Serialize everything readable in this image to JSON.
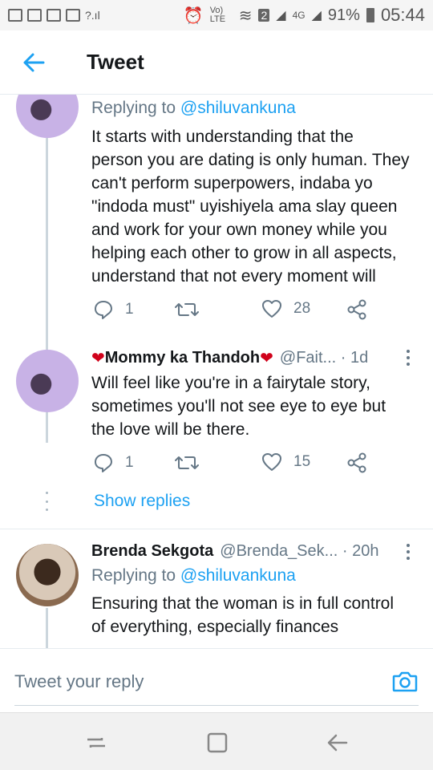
{
  "status_bar": {
    "carrier_lte": "Vo) LTE",
    "sim_slot": "2",
    "network": "4G",
    "battery": "91%",
    "time": "05:44"
  },
  "header": {
    "title": "Tweet"
  },
  "tweets": [
    {
      "replying_prefix": "Replying to ",
      "replying_handle": "@shiluvankuna",
      "lines": [
        "It starts with understanding that the",
        "person you are dating is only human. They",
        "can't perform superpowers, indaba yo",
        "\"indoda must\" uyishiyela ama slay queen",
        "and work for your own money while you",
        "helping each other to grow in all aspects,",
        "understand that not every moment will"
      ],
      "replies": "1",
      "likes": "28"
    },
    {
      "name": "Mommy ka Thandoh",
      "handle_time": "@Fait... · 1d",
      "lines": [
        "Will feel like you're in a fairytale story,",
        "sometimes you'll not see eye to eye but",
        "the love will be there."
      ],
      "replies": "1",
      "likes": "15",
      "show_replies": "Show replies"
    },
    {
      "name": "Brenda Sekgota",
      "handle_time": "@Brenda_Sek... · 20h",
      "replying_prefix": "Replying to ",
      "replying_handle": "@shiluvankuna",
      "lines": [
        "Ensuring that the woman is in full control",
        "of everything, especially finances"
      ]
    }
  ],
  "composer": {
    "placeholder": "Tweet your reply"
  },
  "colors": {
    "accent": "#1da1f2",
    "muted": "#657786",
    "heart": "#d0021b"
  }
}
